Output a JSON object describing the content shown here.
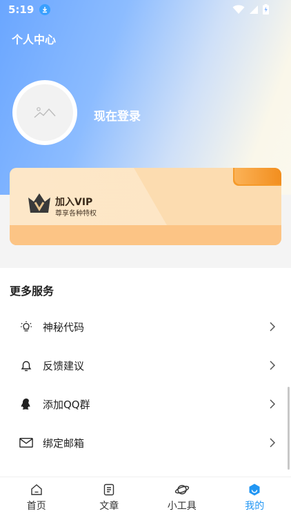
{
  "status_bar": {
    "time": "5:19"
  },
  "header": {
    "title": "个人中心",
    "login_text": "现在登录"
  },
  "vip": {
    "title": "加入VIP",
    "subtitle": "尊享各种特权"
  },
  "services": {
    "title": "更多服务",
    "items": [
      {
        "label": "神秘代码",
        "icon": "bulb-icon"
      },
      {
        "label": "反馈建议",
        "icon": "bell-icon"
      },
      {
        "label": "添加QQ群",
        "icon": "qq-icon"
      },
      {
        "label": "绑定邮箱",
        "icon": "mail-icon"
      }
    ]
  },
  "nav": {
    "items": [
      {
        "label": "首页",
        "icon": "home-icon"
      },
      {
        "label": "文章",
        "icon": "article-icon"
      },
      {
        "label": "小工具",
        "icon": "planet-icon"
      },
      {
        "label": "我的",
        "icon": "profile-icon",
        "active": true
      }
    ]
  },
  "colors": {
    "accent": "#2196f3",
    "vip_orange": "#f59a2a"
  }
}
